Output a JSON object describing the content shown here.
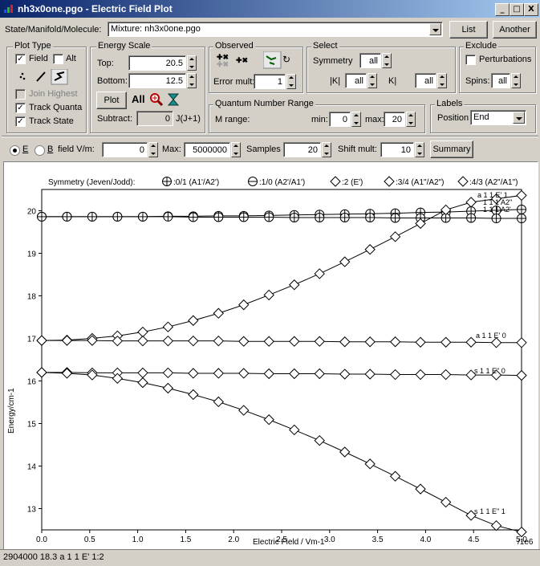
{
  "window": {
    "title": "nh3x0one.pgo - Electric Field Plot",
    "controls": [
      "_",
      "□",
      "X"
    ]
  },
  "top": {
    "label": "State/Manifold/Molecule:",
    "combo_value": "Mixture: nh3x0one.pgo",
    "list_button": "List",
    "another_button": "Another"
  },
  "plot_type": {
    "title": "Plot Type",
    "field": "Field",
    "alt": "Alt",
    "join_highest": "Join Highest",
    "track_quanta": "Track Quanta",
    "track_state": "Track State"
  },
  "energy_scale": {
    "title": "Energy Scale",
    "top_label": "Top:",
    "top_value": "20.5",
    "bottom_label": "Bottom:",
    "bottom_value": "12.5",
    "plot_button": "Plot",
    "all_label": "All",
    "subtract_label": "Subtract:",
    "subtract_value": "0",
    "subtract_suffix": "J(J+1)"
  },
  "observed": {
    "title": "Observed",
    "error_mult_label": "Error mult:",
    "error_mult_value": "1"
  },
  "select": {
    "title": "Select",
    "symmetry_label": "Symmetry",
    "symmetry_value": "all",
    "absk_label": "|K|",
    "absk_value": "all",
    "k_label": "K|",
    "k_value": "all"
  },
  "exclude": {
    "title": "Exclude",
    "perturbations": "Perturbations",
    "spins_label": "Spins:",
    "spins_value": "all"
  },
  "qn_range": {
    "title": "Quantum Number Range",
    "m_range_label": "M range:",
    "min_label": "min:",
    "min_value": "0",
    "max_label": "max:",
    "max_value": "20"
  },
  "labels": {
    "title": "Labels",
    "position_label": "Position",
    "position_value": "End"
  },
  "field_row": {
    "e_label": "E",
    "b_label": "B",
    "field_label": "field V/m:",
    "field_value": "0",
    "max_label": "Max:",
    "max_value": "5000000",
    "samples_label": "Samples",
    "samples_value": "20",
    "shift_label": "Shift mult:",
    "shift_value": "10",
    "summary_button": "Summary"
  },
  "legend": {
    "title": "Symmetry (Jeven/Jodd):",
    "entries": [
      "0/1 (A1'/A2')",
      "1/0 (A2'/A1')",
      "2 (E')",
      "3/4 (A1\"/A2\")",
      "4/3 (A2\"/A1\")"
    ]
  },
  "chart_data": {
    "type": "line",
    "xlabel": "Electric Field / Vm-1",
    "ylabel": "Energy/cm-1",
    "x_scale_label": "/1e6",
    "xlim": [
      0,
      5.0
    ],
    "ylim": [
      12.5,
      20.5
    ],
    "xticks": [
      "0.0",
      "0.5",
      "1.0",
      "1.5",
      "2.0",
      "2.5",
      "3.0",
      "3.5",
      "4.0",
      "4.5",
      "5.0"
    ],
    "yticks": [
      "13",
      "14",
      "15",
      "16",
      "17",
      "18",
      "19",
      "20"
    ],
    "x": [
      0.0,
      0.263,
      0.526,
      0.789,
      1.053,
      1.316,
      1.579,
      1.842,
      2.105,
      2.368,
      2.632,
      2.895,
      3.158,
      3.421,
      3.684,
      3.947,
      4.211,
      4.474,
      4.737,
      5.0
    ],
    "series": [
      {
        "marker": "circle-plus",
        "values": [
          19.86,
          19.86,
          19.86,
          19.86,
          19.86,
          19.87,
          19.87,
          19.88,
          19.88,
          19.89,
          19.9,
          19.91,
          19.92,
          19.93,
          19.94,
          19.96,
          19.97,
          19.99,
          20.01,
          20.03
        ]
      },
      {
        "marker": "circle-plus",
        "values": [
          19.86,
          19.86,
          19.86,
          19.86,
          19.86,
          19.86,
          19.85,
          19.85,
          19.85,
          19.85,
          19.84,
          19.84,
          19.84,
          19.84,
          19.83,
          19.83,
          19.83,
          19.83,
          19.82,
          19.82
        ]
      },
      {
        "marker": "diamond",
        "values": [
          16.95,
          16.96,
          17.0,
          17.06,
          17.15,
          17.27,
          17.42,
          17.59,
          17.79,
          18.02,
          18.26,
          18.52,
          18.8,
          19.09,
          19.39,
          19.7,
          20.02,
          20.2,
          20.28,
          20.36
        ]
      },
      {
        "marker": "diamond",
        "values": [
          16.95,
          16.95,
          16.95,
          16.94,
          16.94,
          16.94,
          16.94,
          16.94,
          16.93,
          16.93,
          16.93,
          16.93,
          16.92,
          16.92,
          16.92,
          16.91,
          16.91,
          16.91,
          16.9,
          16.9
        ]
      },
      {
        "marker": "diamond",
        "values": [
          16.2,
          16.2,
          16.19,
          16.19,
          16.19,
          16.19,
          16.18,
          16.18,
          16.18,
          16.17,
          16.17,
          16.17,
          16.16,
          16.16,
          16.15,
          16.15,
          16.15,
          16.14,
          16.14,
          16.13
        ]
      },
      {
        "marker": "diamond",
        "values": [
          16.2,
          16.18,
          16.14,
          16.06,
          15.96,
          15.83,
          15.68,
          15.51,
          15.31,
          15.09,
          14.85,
          14.6,
          14.33,
          14.05,
          13.76,
          13.46,
          13.15,
          12.84,
          12.6,
          12.45
        ]
      }
    ],
    "annotations": [
      "a 1 1 E' 1",
      "1 1 1 A2\"",
      "1 1 1 A2'",
      "a 1 1 E' 0",
      "s 1 1 E\" 0",
      "s 1 1 E\" 1"
    ]
  },
  "status": {
    "text": "2904000  18.3 a  1  1 E'  1:2"
  }
}
